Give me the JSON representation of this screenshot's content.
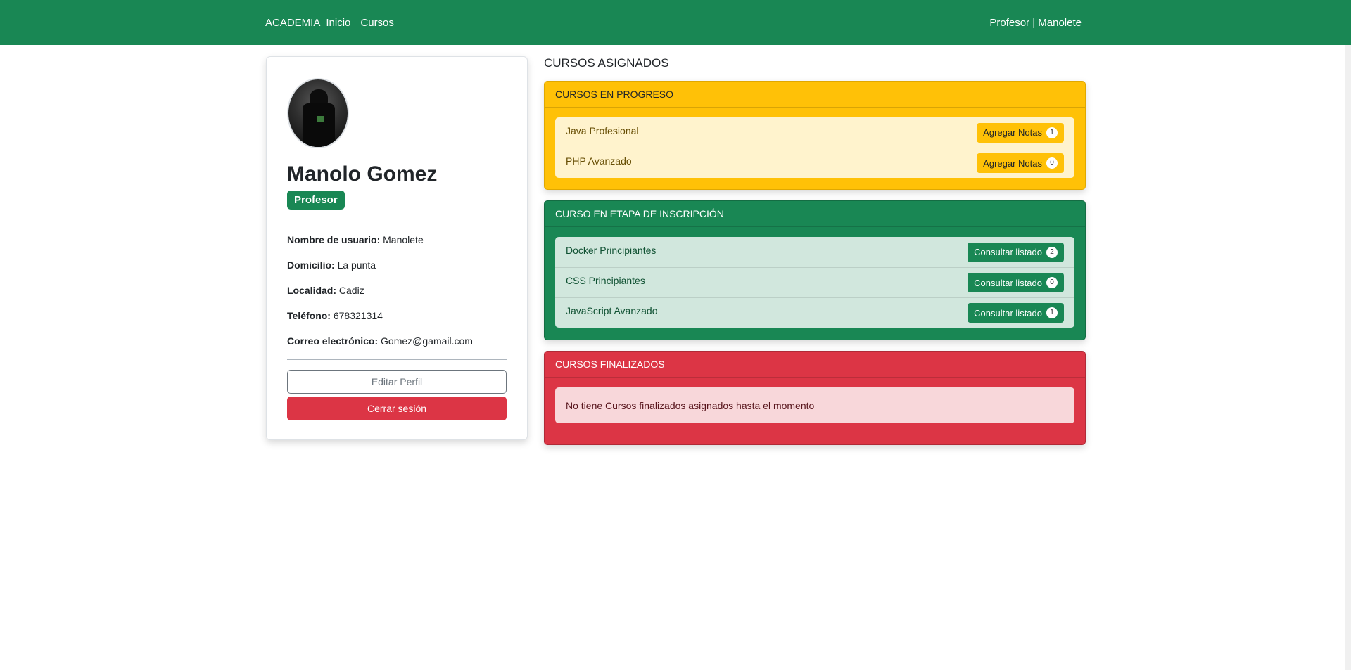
{
  "nav": {
    "brand": "ACADEMIA",
    "links": [
      "Inicio",
      "Cursos"
    ],
    "user": "Profesor | Manolete"
  },
  "profile": {
    "name": "Manolo Gomez",
    "role": "Profesor",
    "fields": [
      {
        "label": "Nombre de usuario:",
        "value": "Manolete"
      },
      {
        "label": "Domicilio:",
        "value": "La punta"
      },
      {
        "label": "Localidad:",
        "value": "Cadiz"
      },
      {
        "label": "Teléfono:",
        "value": "678321314"
      },
      {
        "label": "Correo electrónico:",
        "value": "Gomez@gamail.com"
      }
    ],
    "edit_label": "Editar Perfil",
    "logout_label": "Cerrar sesión"
  },
  "courses": {
    "title": "CURSOS ASIGNADOS",
    "in_progress": {
      "header": "CURSOS EN PROGRESO",
      "items": [
        {
          "name": "Java Profesional",
          "action": "Agregar Notas",
          "count": "1"
        },
        {
          "name": "PHP Avanzado",
          "action": "Agregar Notas",
          "count": "0"
        }
      ]
    },
    "enrollment": {
      "header": "CURSO EN ETAPA DE INSCRIPCIÓN",
      "items": [
        {
          "name": "Docker Principiantes",
          "action": "Consultar listado",
          "count": "2"
        },
        {
          "name": "CSS Principiantes",
          "action": "Consultar listado",
          "count": "0"
        },
        {
          "name": "JavaScript Avanzado",
          "action": "Consultar listado",
          "count": "1"
        }
      ]
    },
    "finished": {
      "header": "CURSOS FINALIZADOS",
      "empty_message": "No tiene Cursos finalizados asignados hasta el momento"
    }
  },
  "colors": {
    "primary_green": "#198754",
    "warning_yellow": "#ffc107",
    "danger_red": "#dc3545"
  }
}
